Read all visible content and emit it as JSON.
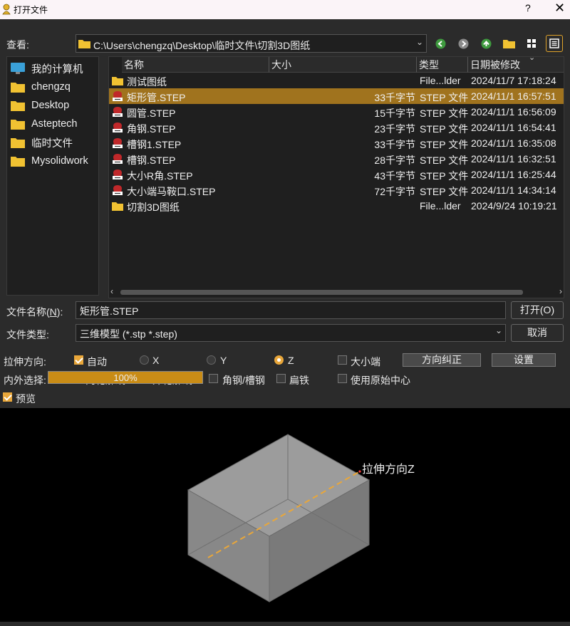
{
  "window": {
    "title": "打开文件",
    "help": "?",
    "close": "✕"
  },
  "lookin": {
    "label": "查看:",
    "path": "C:\\Users\\chengzq\\Desktop\\临时文件\\切割3D图纸"
  },
  "places": [
    {
      "label": "我的计算机",
      "icon": "computer-icon"
    },
    {
      "label": "chengzq",
      "icon": "folder-icon"
    },
    {
      "label": "Desktop",
      "icon": "folder-icon"
    },
    {
      "label": "Asteptech",
      "icon": "folder-icon"
    },
    {
      "label": "临时文件",
      "icon": "folder-icon"
    },
    {
      "label": "Mysolidwork",
      "icon": "folder-icon"
    }
  ],
  "columns": {
    "name": "名称",
    "size": "大小",
    "type": "类型",
    "modified": "日期被修改"
  },
  "files": [
    {
      "name": "测试图纸",
      "size": "",
      "type": "File...lder",
      "modified": "2024/11/7 17:18:24",
      "icon": "folder-icon",
      "selected": false
    },
    {
      "name": "矩形管.STEP",
      "size": "33千字节",
      "type": "STEP 文件",
      "modified": "2024/11/1 16:57:51",
      "icon": "step-file-icon",
      "selected": true
    },
    {
      "name": "圆管.STEP",
      "size": "15千字节",
      "type": "STEP 文件",
      "modified": "2024/11/1 16:56:09",
      "icon": "step-file-icon",
      "selected": false
    },
    {
      "name": "角钢.STEP",
      "size": "23千字节",
      "type": "STEP 文件",
      "modified": "2024/11/1 16:54:41",
      "icon": "step-file-icon",
      "selected": false
    },
    {
      "name": "槽钢1.STEP",
      "size": "33千字节",
      "type": "STEP 文件",
      "modified": "2024/11/1 16:35:08",
      "icon": "step-file-icon",
      "selected": false
    },
    {
      "name": "槽钢.STEP",
      "size": "28千字节",
      "type": "STEP 文件",
      "modified": "2024/11/1 16:32:51",
      "icon": "step-file-icon",
      "selected": false
    },
    {
      "name": "大小R角.STEP",
      "size": "43千字节",
      "type": "STEP 文件",
      "modified": "2024/11/1 16:25:44",
      "icon": "step-file-icon",
      "selected": false
    },
    {
      "name": "大小端马鞍口.STEP",
      "size": "72千字节",
      "type": "STEP 文件",
      "modified": "2024/11/1 14:34:14",
      "icon": "step-file-icon",
      "selected": false
    },
    {
      "name": "切割3D图纸",
      "size": "",
      "type": "File...lder",
      "modified": "2024/9/24 10:19:21",
      "icon": "folder-icon",
      "selected": false
    }
  ],
  "filename": {
    "label_pre": "文件名称(",
    "label_key": "N",
    "label_post": "):",
    "value": "矩形管.STEP"
  },
  "filetype": {
    "label": "文件类型:",
    "value": "三维模型 (*.stp *.step)"
  },
  "buttons": {
    "open": "打开(O)",
    "cancel": "取消",
    "fix_direction": "方向纠正",
    "settings": "设置"
  },
  "options": {
    "stretch_label": "拉伸方向:",
    "auto": "自动",
    "x": "X",
    "y": "Y",
    "z": "Z",
    "big_small_end": "大小端",
    "inout_label": "内外选择:",
    "inner": "内轮廓线",
    "outer": "外轮廓线",
    "angle_channel": "角钢/槽钢",
    "flat_iron": "扁铁",
    "use_origin": "使用原始中心",
    "preview": "预览"
  },
  "progress": {
    "value": 100,
    "text": "100%"
  },
  "preview": {
    "axis_label": "拉伸方向Z"
  },
  "colors": {
    "accent": "#e9a73a",
    "selected_row": "#a0731e",
    "background": "#2b2b2b"
  }
}
